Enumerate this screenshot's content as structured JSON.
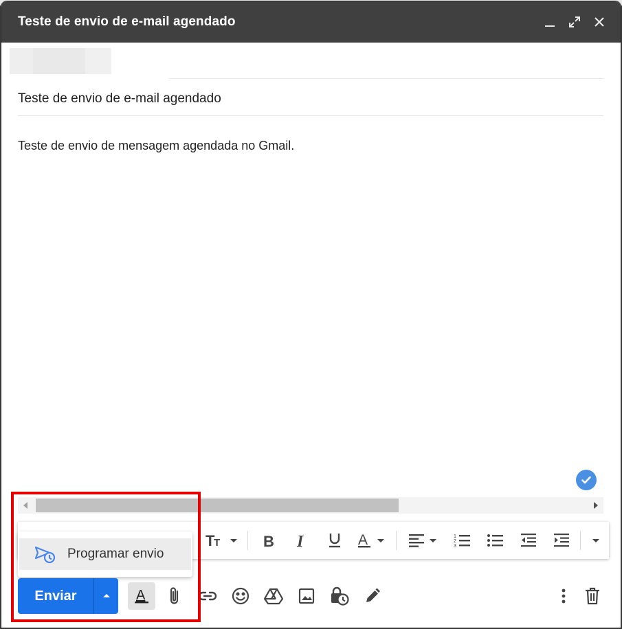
{
  "window": {
    "title": "Teste de envio de e-mail agendado"
  },
  "compose": {
    "subject": "Teste de envio de e-mail agendado",
    "body": "Teste de envio de mensagem agendada no Gmail."
  },
  "schedule_menu": {
    "item_label": "Programar envio"
  },
  "actions": {
    "send_label": "Enviar"
  },
  "colors": {
    "titlebar": "#404040",
    "send_button": "#1a73e8",
    "highlight_box": "#e50000",
    "check_badge": "#4a90e2"
  },
  "icons": [
    "minimize-icon",
    "expand-icon",
    "close-icon",
    "check-circle-icon",
    "text-size-icon",
    "bold-icon",
    "italic-icon",
    "underline-icon",
    "text-color-icon",
    "align-icon",
    "numbered-list-icon",
    "bulleted-list-icon",
    "indent-less-icon",
    "indent-more-icon",
    "more-formatting-icon",
    "schedule-send-icon",
    "caret-up-icon",
    "formatting-toggle-icon",
    "attach-icon",
    "link-icon",
    "emoji-icon",
    "drive-icon",
    "photo-icon",
    "confidential-icon",
    "signature-icon",
    "more-options-icon",
    "trash-icon"
  ]
}
